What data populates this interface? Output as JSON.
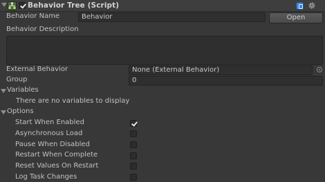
{
  "component": {
    "title": "Behavior Tree (Script)",
    "enabled": true
  },
  "fields": {
    "behavior_name_label": "Behavior Name",
    "behavior_name_value": "Behavior",
    "open_button": "Open",
    "behavior_description_label": "Behavior Description",
    "behavior_description_value": "",
    "external_behavior_label": "External Behavior",
    "external_behavior_value": "None (External Behavior)",
    "group_label": "Group",
    "group_value": "0"
  },
  "variables": {
    "label": "Variables",
    "empty_message": "There are no variables to display"
  },
  "options": {
    "label": "Options",
    "items": [
      {
        "label": "Start When Enabled",
        "checked": true
      },
      {
        "label": "Asynchronous Load",
        "checked": false
      },
      {
        "label": "Pause When Disabled",
        "checked": false
      },
      {
        "label": "Restart When Complete",
        "checked": false
      },
      {
        "label": "Reset Values On Restart",
        "checked": false
      },
      {
        "label": "Log Task Changes",
        "checked": false
      }
    ]
  },
  "icons": {
    "foldout": "foldout-arrow-icon",
    "component": "behavior-tree-component-icon",
    "help": "help-book-icon",
    "gear": "gear-icon",
    "object_picker": "object-picker-icon"
  },
  "colors": {
    "background": "#383838",
    "field_background": "#2f2f2f",
    "help_blue": "#3f86d6"
  }
}
